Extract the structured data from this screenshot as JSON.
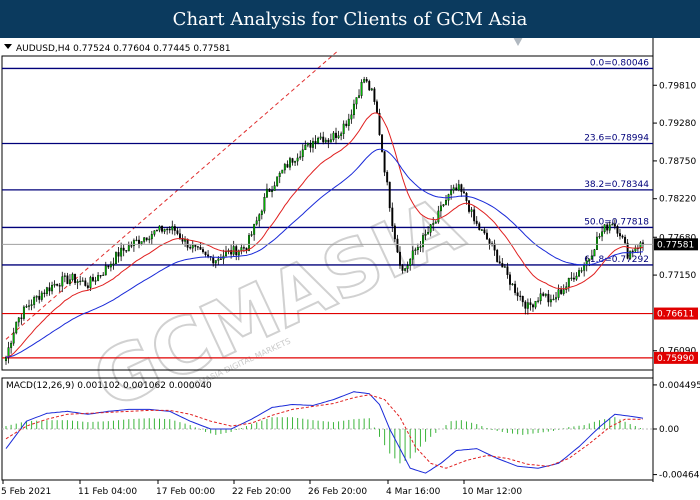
{
  "banner": {
    "title": "Chart Analysis for Clients of GCM Asia"
  },
  "chart_data": {
    "type": "candlestick",
    "symbol_line": "AUDUSD,H4  0.77524 0.77604 0.77445 0.77581",
    "ylim": [
      0.7582,
      0.8022
    ],
    "y_ticks": [
      0.7981,
      0.7928,
      0.7875,
      0.7822,
      0.7768,
      0.7715,
      0.7609
    ],
    "x_labels": [
      "5 Feb 2021",
      "11 Feb 04:00",
      "17 Feb 00:00",
      "22 Feb 20:00",
      "26 Feb 20:00",
      "4 Mar 16:00",
      "10 Mar 12:00"
    ],
    "fib_levels": [
      {
        "label": "0.0=0.80046",
        "value": 0.80046
      },
      {
        "label": "23.6=0.78994",
        "value": 0.78994
      },
      {
        "label": "38.2=0.78344",
        "value": 0.78344
      },
      {
        "label": "50.0=0.77818",
        "value": 0.77818
      },
      {
        "label": "61.8=0.77292",
        "value": 0.77292
      }
    ],
    "support_levels": [
      {
        "label": "0.76611",
        "value": 0.76611
      },
      {
        "label": "0.75990",
        "value": 0.7599
      }
    ],
    "current_price": {
      "label": "0.77581",
      "value": 0.77581
    },
    "price_path": [
      [
        0,
        0.76
      ],
      [
        4,
        0.765
      ],
      [
        8,
        0.767
      ],
      [
        14,
        0.769
      ],
      [
        20,
        0.7705
      ],
      [
        26,
        0.771
      ],
      [
        32,
        0.7702
      ],
      [
        38,
        0.772
      ],
      [
        44,
        0.7745
      ],
      [
        50,
        0.776
      ],
      [
        56,
        0.7772
      ],
      [
        62,
        0.778
      ],
      [
        66,
        0.7778
      ],
      [
        70,
        0.7762
      ],
      [
        74,
        0.775
      ],
      [
        78,
        0.774
      ],
      [
        82,
        0.7738
      ],
      [
        86,
        0.7745
      ],
      [
        90,
        0.775
      ],
      [
        94,
        0.7755
      ],
      [
        98,
        0.779
      ],
      [
        102,
        0.783
      ],
      [
        106,
        0.785
      ],
      [
        110,
        0.787
      ],
      [
        114,
        0.7885
      ],
      [
        118,
        0.7895
      ],
      [
        122,
        0.791
      ],
      [
        126,
        0.7905
      ],
      [
        130,
        0.7915
      ],
      [
        134,
        0.7935
      ],
      [
        137,
        0.7965
      ],
      [
        140,
        0.799
      ],
      [
        143,
        0.797
      ],
      [
        145,
        0.794
      ],
      [
        147,
        0.789
      ],
      [
        149,
        0.784
      ],
      [
        151,
        0.779
      ],
      [
        153,
        0.775
      ],
      [
        155,
        0.772
      ],
      [
        157,
        0.773
      ],
      [
        160,
        0.775
      ],
      [
        164,
        0.777
      ],
      [
        168,
        0.779
      ],
      [
        171,
        0.7815
      ],
      [
        174,
        0.783
      ],
      [
        177,
        0.7835
      ],
      [
        180,
        0.782
      ],
      [
        183,
        0.779
      ],
      [
        186,
        0.7775
      ],
      [
        189,
        0.776
      ],
      [
        192,
        0.774
      ],
      [
        195,
        0.772
      ],
      [
        198,
        0.77
      ],
      [
        201,
        0.7685
      ],
      [
        204,
        0.767
      ],
      [
        207,
        0.768
      ],
      [
        210,
        0.769
      ],
      [
        213,
        0.7675
      ],
      [
        216,
        0.769
      ],
      [
        219,
        0.77
      ],
      [
        222,
        0.7715
      ],
      [
        225,
        0.7725
      ],
      [
        228,
        0.774
      ],
      [
        231,
        0.7765
      ],
      [
        234,
        0.778
      ],
      [
        237,
        0.779
      ],
      [
        240,
        0.7775
      ],
      [
        243,
        0.7745
      ],
      [
        246,
        0.7755
      ],
      [
        249,
        0.7758
      ]
    ],
    "macd": {
      "label": "MACD(12,26,9) 0.001102 0.001062 0.000040",
      "y_ticks": [
        0.004495,
        0.0,
        -0.004649
      ],
      "ylim": [
        -0.0052,
        0.0052
      ],
      "histogram": [
        [
          0,
          0.0003
        ],
        [
          8,
          0.0008
        ],
        [
          16,
          0.0009
        ],
        [
          24,
          0.0009
        ],
        [
          32,
          0.0007
        ],
        [
          40,
          0.0008
        ],
        [
          48,
          0.001
        ],
        [
          56,
          0.0011
        ],
        [
          64,
          0.001
        ],
        [
          72,
          0.0004
        ],
        [
          78,
          -0.0003
        ],
        [
          82,
          -0.0006
        ],
        [
          88,
          -0.0003
        ],
        [
          96,
          0.0005
        ],
        [
          104,
          0.0012
        ],
        [
          112,
          0.0012
        ],
        [
          120,
          0.0009
        ],
        [
          128,
          0.0007
        ],
        [
          136,
          0.001
        ],
        [
          142,
          0.0011
        ],
        [
          146,
          -0.0008
        ],
        [
          150,
          -0.0025
        ],
        [
          154,
          -0.0035
        ],
        [
          158,
          -0.003
        ],
        [
          162,
          -0.0018
        ],
        [
          166,
          -0.0008
        ],
        [
          170,
          0.0
        ],
        [
          174,
          0.0008
        ],
        [
          178,
          0.0009
        ],
        [
          184,
          0.0005
        ],
        [
          190,
          -0.0001
        ],
        [
          196,
          -0.0004
        ],
        [
          202,
          -0.0006
        ],
        [
          208,
          -0.0004
        ],
        [
          214,
          -0.0002
        ],
        [
          220,
          0.0002
        ],
        [
          226,
          0.0004
        ],
        [
          232,
          0.0009
        ],
        [
          238,
          0.0012
        ],
        [
          244,
          0.0005
        ],
        [
          249,
          0.0
        ]
      ],
      "main_line": [
        [
          0,
          -0.002
        ],
        [
          8,
          0.0008
        ],
        [
          16,
          0.0016
        ],
        [
          24,
          0.0018
        ],
        [
          32,
          0.0015
        ],
        [
          40,
          0.0018
        ],
        [
          48,
          0.002
        ],
        [
          56,
          0.002
        ],
        [
          64,
          0.0018
        ],
        [
          72,
          0.0008
        ],
        [
          80,
          0.0
        ],
        [
          88,
          0.0
        ],
        [
          96,
          0.001
        ],
        [
          104,
          0.0022
        ],
        [
          112,
          0.0025
        ],
        [
          120,
          0.0024
        ],
        [
          128,
          0.003
        ],
        [
          136,
          0.0038
        ],
        [
          142,
          0.0036
        ],
        [
          146,
          0.0025
        ],
        [
          150,
          0.0
        ],
        [
          154,
          -0.002
        ],
        [
          158,
          -0.004
        ],
        [
          164,
          -0.0045
        ],
        [
          170,
          -0.0035
        ],
        [
          176,
          -0.0022
        ],
        [
          184,
          -0.002
        ],
        [
          192,
          -0.003
        ],
        [
          200,
          -0.0038
        ],
        [
          208,
          -0.004
        ],
        [
          216,
          -0.0035
        ],
        [
          224,
          -0.0018
        ],
        [
          232,
          0.0002
        ],
        [
          238,
          0.0015
        ],
        [
          244,
          0.0013
        ],
        [
          249,
          0.0011
        ]
      ],
      "signal_line": [
        [
          0,
          -0.001
        ],
        [
          8,
          0.0003
        ],
        [
          16,
          0.001
        ],
        [
          24,
          0.0015
        ],
        [
          32,
          0.0016
        ],
        [
          40,
          0.0017
        ],
        [
          48,
          0.0018
        ],
        [
          56,
          0.0019
        ],
        [
          64,
          0.0019
        ],
        [
          72,
          0.0015
        ],
        [
          80,
          0.0008
        ],
        [
          88,
          0.0003
        ],
        [
          96,
          0.0006
        ],
        [
          104,
          0.0014
        ],
        [
          112,
          0.002
        ],
        [
          120,
          0.0023
        ],
        [
          128,
          0.0026
        ],
        [
          136,
          0.0032
        ],
        [
          142,
          0.0035
        ],
        [
          148,
          0.003
        ],
        [
          154,
          0.0012
        ],
        [
          160,
          -0.0018
        ],
        [
          166,
          -0.0035
        ],
        [
          172,
          -0.004
        ],
        [
          180,
          -0.0032
        ],
        [
          188,
          -0.0027
        ],
        [
          196,
          -0.003
        ],
        [
          204,
          -0.0036
        ],
        [
          212,
          -0.0038
        ],
        [
          220,
          -0.003
        ],
        [
          228,
          -0.0015
        ],
        [
          236,
          0.0002
        ],
        [
          242,
          0.001
        ],
        [
          249,
          0.001
        ]
      ]
    },
    "watermark": "GCMASIA",
    "watermark_sub": "GCMASIA DIGITAL MARKETS"
  }
}
